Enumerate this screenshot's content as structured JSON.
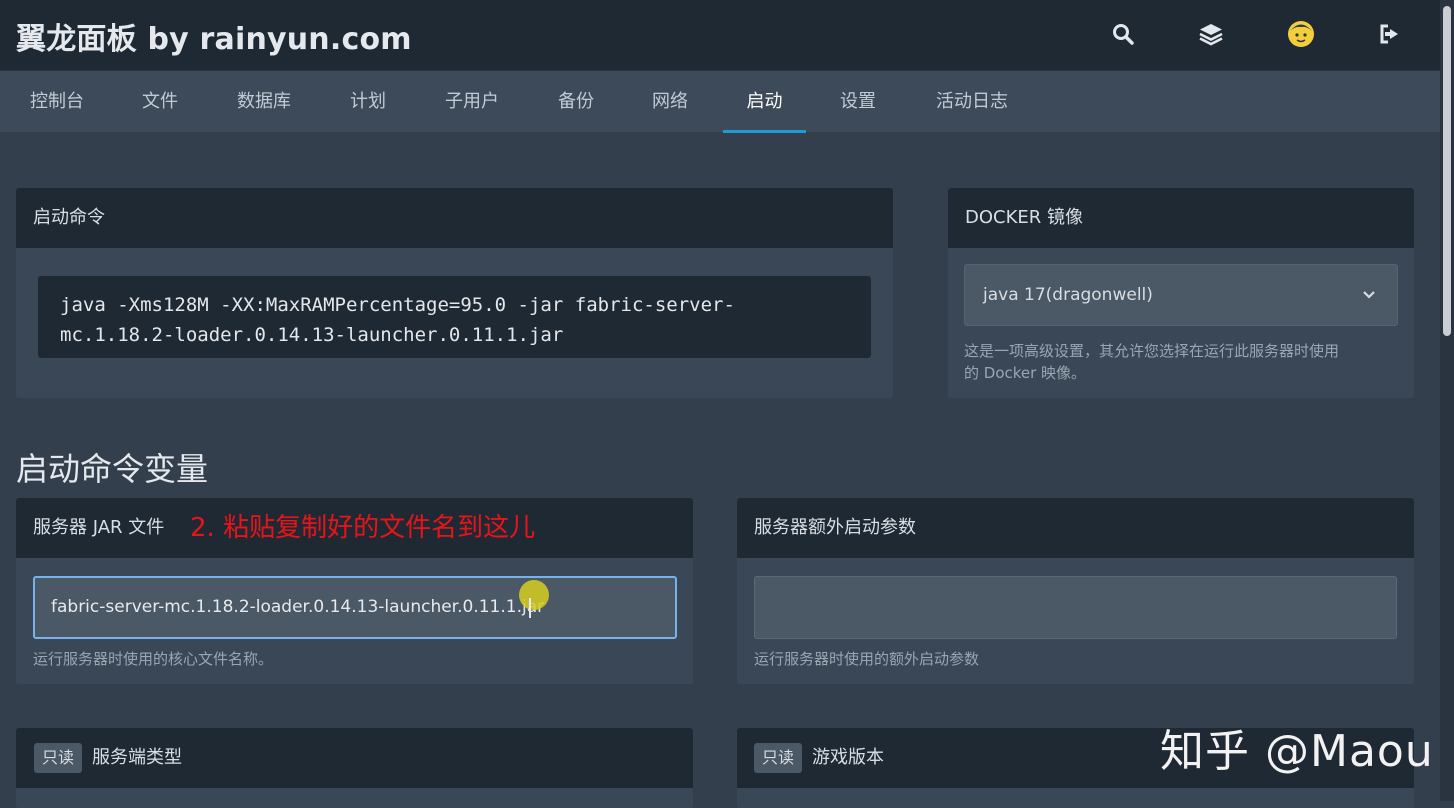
{
  "header": {
    "title": "翼龙面板 by rainyun.com",
    "icons": [
      "search-icon",
      "layers-icon",
      "avatar",
      "logout-icon"
    ]
  },
  "nav": {
    "tabs": [
      {
        "label": "控制台"
      },
      {
        "label": "文件"
      },
      {
        "label": "数据库"
      },
      {
        "label": "计划"
      },
      {
        "label": "子用户"
      },
      {
        "label": "备份"
      },
      {
        "label": "网络"
      },
      {
        "label": "启动",
        "active": true
      },
      {
        "label": "设置"
      },
      {
        "label": "活动日志"
      }
    ]
  },
  "startup_command": {
    "heading": "启动命令",
    "command_line1": "java -Xms128M -XX:MaxRAMPercentage=95.0 -jar fabric-server-",
    "command_line2": "mc.1.18.2-loader.0.14.13-launcher.0.11.1.jar"
  },
  "docker_image": {
    "heading": "DOCKER 镜像",
    "selected": "java 17(dragonwell)",
    "help_line1": "这是一项高级设置，其允许您选择在运行此服务器时使用",
    "help_line2": "的 Docker 映像。"
  },
  "variables": {
    "section_title": "启动命令变量",
    "jar_file": {
      "heading": "服务器 JAR 文件",
      "annotation": "2. 粘贴复制好的文件名到这儿",
      "value": "fabric-server-mc.1.18.2-loader.0.14.13-launcher.0.11.1.jar",
      "help": "运行服务器时使用的核心文件名称。"
    },
    "extra_args": {
      "heading": "服务器额外启动参数",
      "value": "",
      "help": "运行服务器时使用的额外启动参数"
    },
    "server_type": {
      "badge": "只读",
      "heading": "服务端类型"
    },
    "game_version": {
      "badge": "只读",
      "heading": "游戏版本"
    }
  },
  "watermark": "知乎 @Maou",
  "colors": {
    "accent": "#1f9ad6",
    "annotation": "#e8141a",
    "header_bg": "#1f2933",
    "page_bg": "#333f4d"
  }
}
